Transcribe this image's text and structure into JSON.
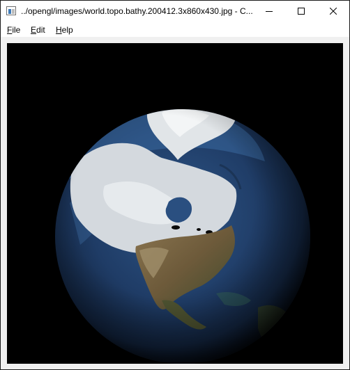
{
  "window": {
    "title": "../opengl/images/world.topo.bathy.200412.3x860x430.jpg - C..."
  },
  "titlebar": {
    "icons": [
      "app-icon",
      "minimize-icon",
      "maximize-icon",
      "close-icon"
    ]
  },
  "menubar": {
    "items": [
      {
        "mnemonic": "F",
        "rest": "ile"
      },
      {
        "mnemonic": "E",
        "rest": "dit"
      },
      {
        "mnemonic": "H",
        "rest": "elp"
      }
    ]
  },
  "viewport": {
    "content": "rendered globe of Earth centered on North America and the Arctic"
  },
  "colors": {
    "background": "#000000",
    "ocean": "#23406a",
    "ice": "#dde2e6",
    "land": "#7d6845"
  }
}
